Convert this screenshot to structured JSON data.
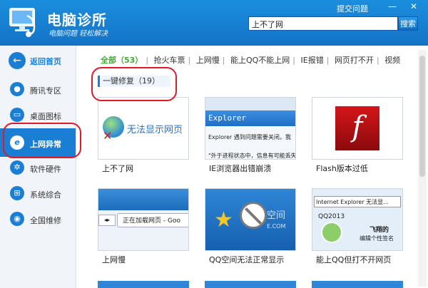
{
  "app": {
    "title": "电脑诊所",
    "slogan": "电脑问题 轻松解决"
  },
  "window": {
    "submit_link": "提交问题",
    "min_glyph": "—",
    "close_glyph": "✕"
  },
  "search": {
    "value": "上不了网",
    "button": "搜索"
  },
  "sidebar": {
    "items": [
      {
        "label": "返回首页",
        "icon": "back-arrow-icon",
        "glyph": "←"
      },
      {
        "label": "腾讯专区",
        "icon": "qq-penguin-icon",
        "glyph": "●"
      },
      {
        "label": "桌面图标",
        "icon": "monitor-icon",
        "glyph": "▭"
      },
      {
        "label": "上网异常",
        "icon": "ie-icon",
        "glyph": "e"
      },
      {
        "label": "软件硬件",
        "icon": "gear-icon",
        "glyph": "✲"
      },
      {
        "label": "系统综合",
        "icon": "windows-icon",
        "glyph": "⊞"
      },
      {
        "label": "全国维修",
        "icon": "location-icon",
        "glyph": "◉"
      }
    ]
  },
  "filters": [
    "全部（53）",
    "抢火车票",
    "上网慢",
    "能上QQ不能上网",
    "IE报错",
    "网页打不开",
    "视频"
  ],
  "section": {
    "label": "一键修复（19）"
  },
  "cards": [
    {
      "caption": "上不了网",
      "thumb_text": "无法显示网页"
    },
    {
      "caption": "IE浏览器出错崩溃",
      "thumb_title": "Explorer",
      "thumb_line1": "Explorer 遇到问题需要关闭。我",
      "thumb_line2": "\"外于进程状态中，信息有可能丢失"
    },
    {
      "caption": "Flash版本过低",
      "thumb_text": "f"
    },
    {
      "caption": "上网慢",
      "thumb_text": "正在加载网页 - Goo"
    },
    {
      "caption": "QQ空间无法正常显示",
      "thumb_text": "空间",
      "thumb_sub": "E.COM"
    },
    {
      "caption": "能上QQ但打不开网页",
      "thumb_title": "Internet Explorer 无法显...",
      "thumb_qq": "QQ2013",
      "thumb_line1": "飞翔的",
      "thumb_line2": "编辑个性签名"
    }
  ],
  "colors": {
    "titlebar": "#1473c6",
    "accent": "#1a7fd4",
    "filter_active": "#3ab02e",
    "annotation": "#e0182a"
  }
}
